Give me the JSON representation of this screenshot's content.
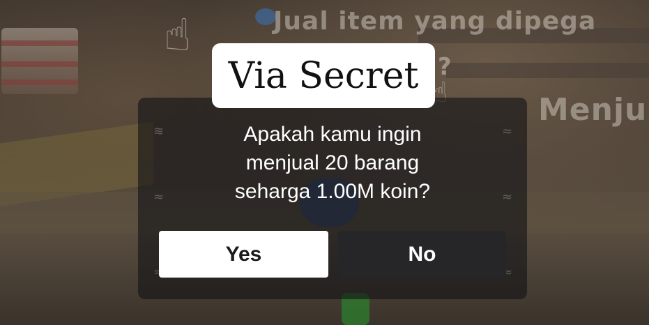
{
  "background_hints": {
    "sell_hint": "Jual item yang dipega",
    "menu_hint": "Menju",
    "question_mark": "?"
  },
  "overlay_title": "Via Secret",
  "dialog": {
    "line1": "Apakah kamu ingin",
    "line2": "menjual 20 barang",
    "line3": "seharga 1.00M koin?",
    "yes_label": "Yes",
    "no_label": "No"
  },
  "colors": {
    "dialog_bg": "#141416",
    "yes_bg": "#ffffff",
    "no_bg": "#262628",
    "title_bg": "#ffffff"
  },
  "icons": [
    "pointing-hand-icon",
    "question-mark-icon",
    "wave-pattern-icon",
    "fish-pattern-icon"
  ]
}
